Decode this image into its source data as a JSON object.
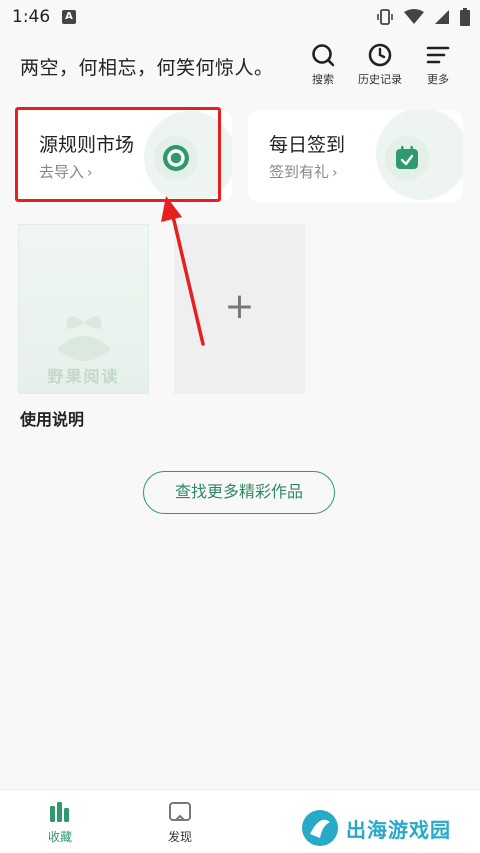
{
  "status_bar": {
    "time": "1:46",
    "notification_glyph": "A"
  },
  "header": {
    "title": "两空，何相忘，何笑何惊人。",
    "actions": [
      {
        "label": "搜索",
        "icon": "search-icon"
      },
      {
        "label": "历史记录",
        "icon": "clock-icon"
      },
      {
        "label": "更多",
        "icon": "menu-icon"
      }
    ]
  },
  "cards": {
    "source_market": {
      "title": "源规则市场",
      "subtitle": "去导入",
      "chevron": "›",
      "icon": "target-icon"
    },
    "daily_checkin": {
      "title": "每日签到",
      "subtitle": "签到有礼",
      "chevron": "›",
      "icon": "calendar-check-icon"
    }
  },
  "shelf": {
    "book_cover_text": "野果阅读",
    "book_caption": "使用说明",
    "add_symbol": "+"
  },
  "find_more_label": "查找更多精彩作品",
  "bottom_nav": [
    {
      "label": "收藏",
      "icon": "bookshelf-icon",
      "active": true
    },
    {
      "label": "发现",
      "icon": "book-open-icon",
      "active": false
    }
  ],
  "watermark": {
    "text": "出海游戏园"
  },
  "colors": {
    "accent": "#2e9a6c",
    "accent_text": "#2e8a63",
    "highlight_red": "#e5201f",
    "background": "#f7f8f7"
  }
}
